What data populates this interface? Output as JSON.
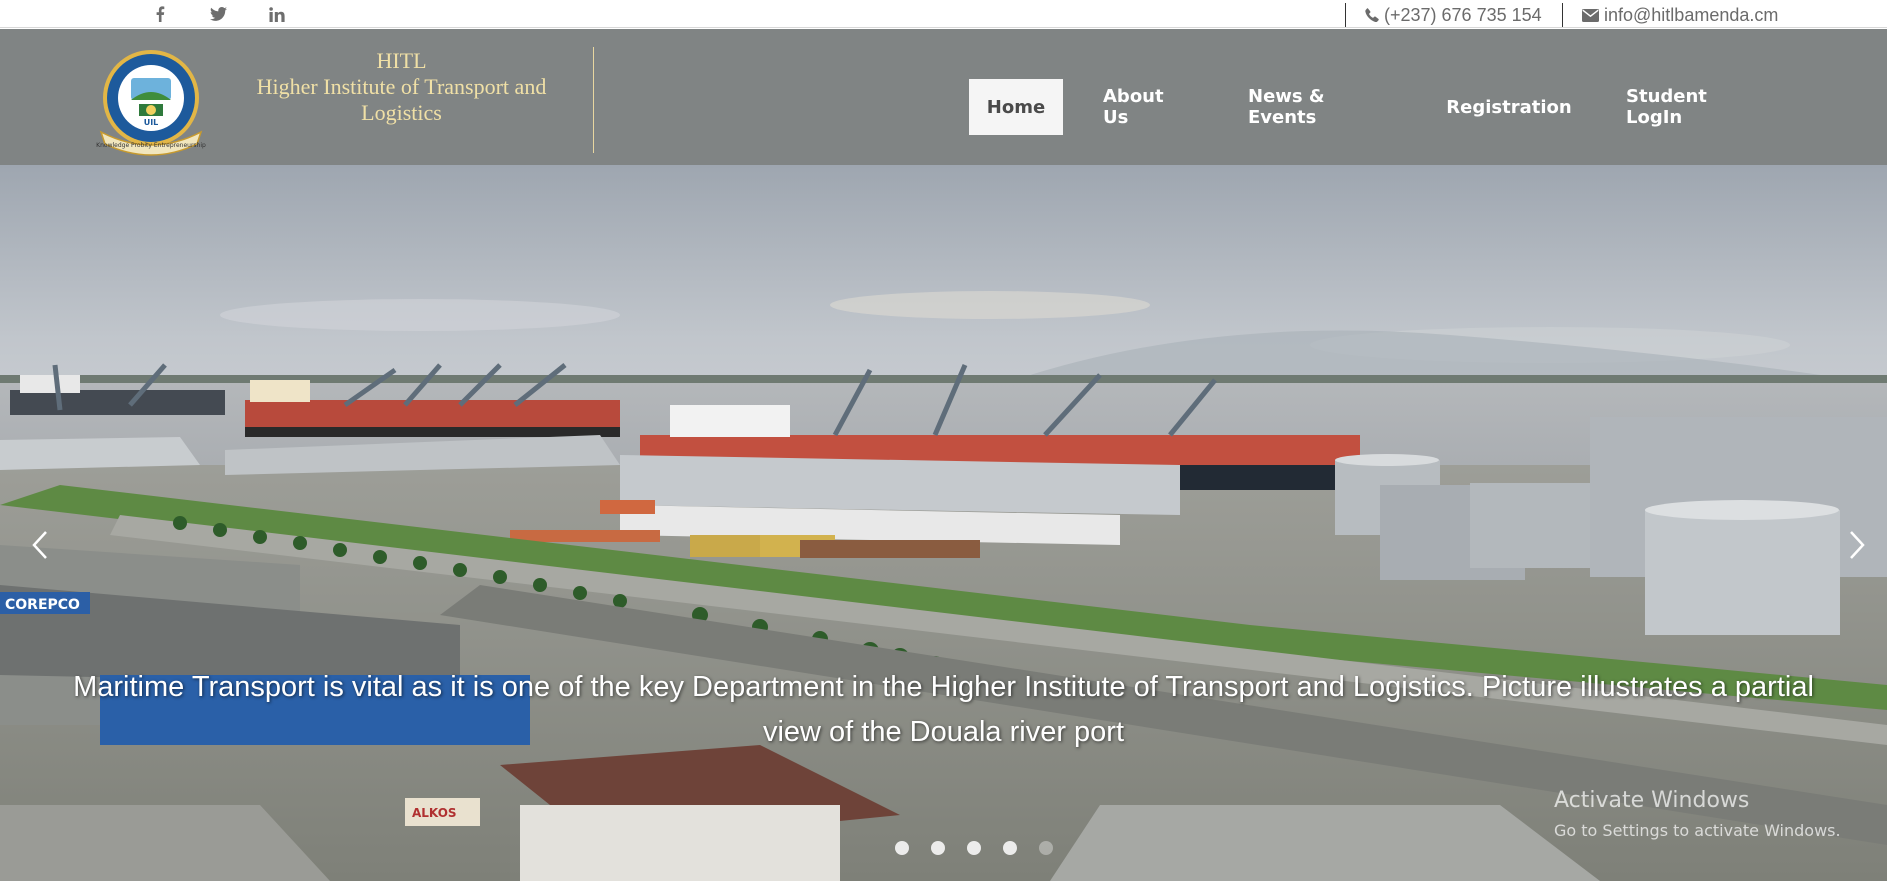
{
  "topbar": {
    "social_icons": [
      "facebook-icon",
      "twitter-icon",
      "linkedin-icon"
    ],
    "phone": "(+237) 676 735 154",
    "email": "info@hitlbamenda.cm"
  },
  "brand": {
    "line1": "HITL",
    "line2": "Higher Institute of Transport and",
    "line3": "Logistics",
    "logo_motto": "Knowledge Probity Entrepreneurship"
  },
  "nav": {
    "items": [
      "Home",
      "About Us",
      "News & Events",
      "Registration",
      "Student LogIn"
    ],
    "active": "Home"
  },
  "hero": {
    "caption_line1": "Maritime Transport is vital as it is one of the key Department in the Higher Institute of Transport and Logistics. Picture illustrates a partial",
    "caption_line2": "view of the Douala river port",
    "slide_count": 5,
    "active_slide": 1,
    "sign_text": "COREPCO",
    "sign_text_2": "ALKOS"
  },
  "watermark": {
    "title": "Activate Windows",
    "subtitle": "Go to Settings to activate Windows."
  },
  "colors": {
    "header_bg": "#808484",
    "brand_text": "#f0e0a6",
    "nav_active_bg": "#f5f5f5",
    "topbar_text": "#6b6b6b"
  }
}
